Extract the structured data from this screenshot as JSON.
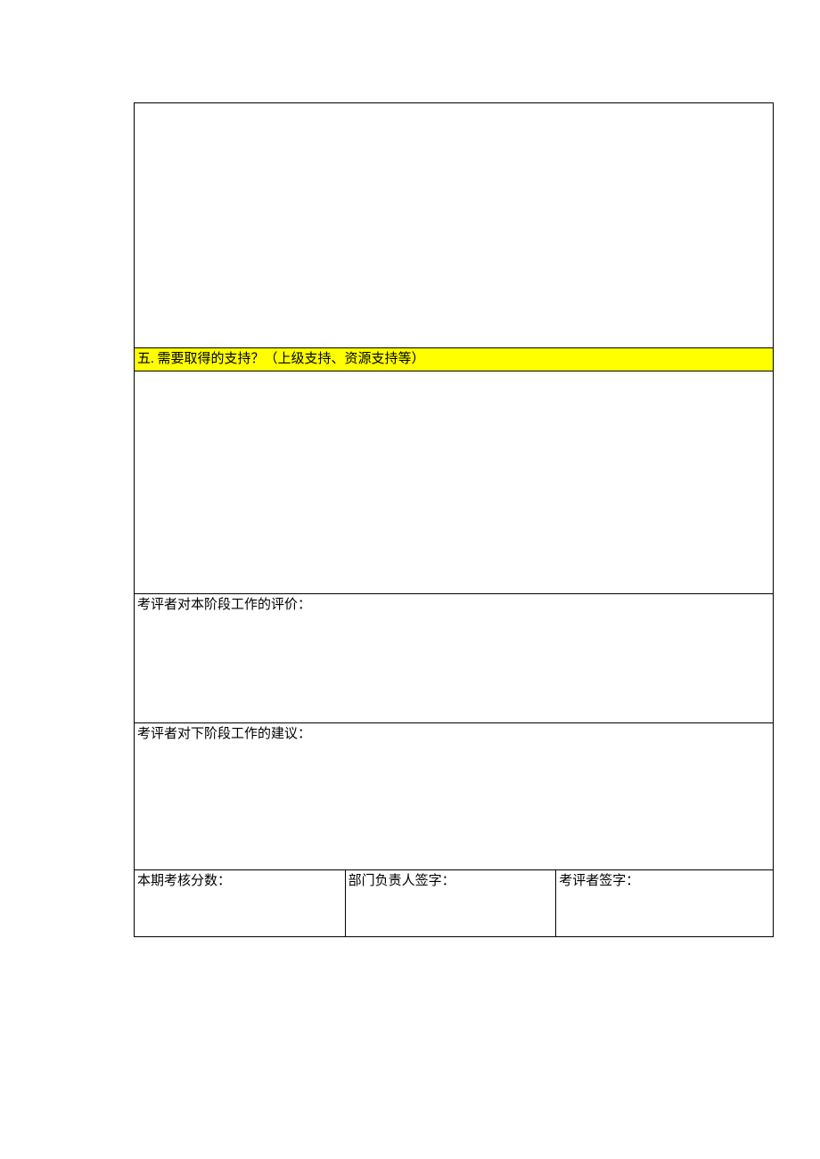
{
  "sections": {
    "support_needed": "五. 需要取得的支持？（上级支持、资源支持等）",
    "evaluator_current": "考评者对本阶段工作的评价：",
    "evaluator_next": "考评者对下阶段工作的建议：",
    "score": "本期考核分数：",
    "dept_sign": "部门负责人签字：",
    "evaluator_sign": "考评者签字："
  }
}
